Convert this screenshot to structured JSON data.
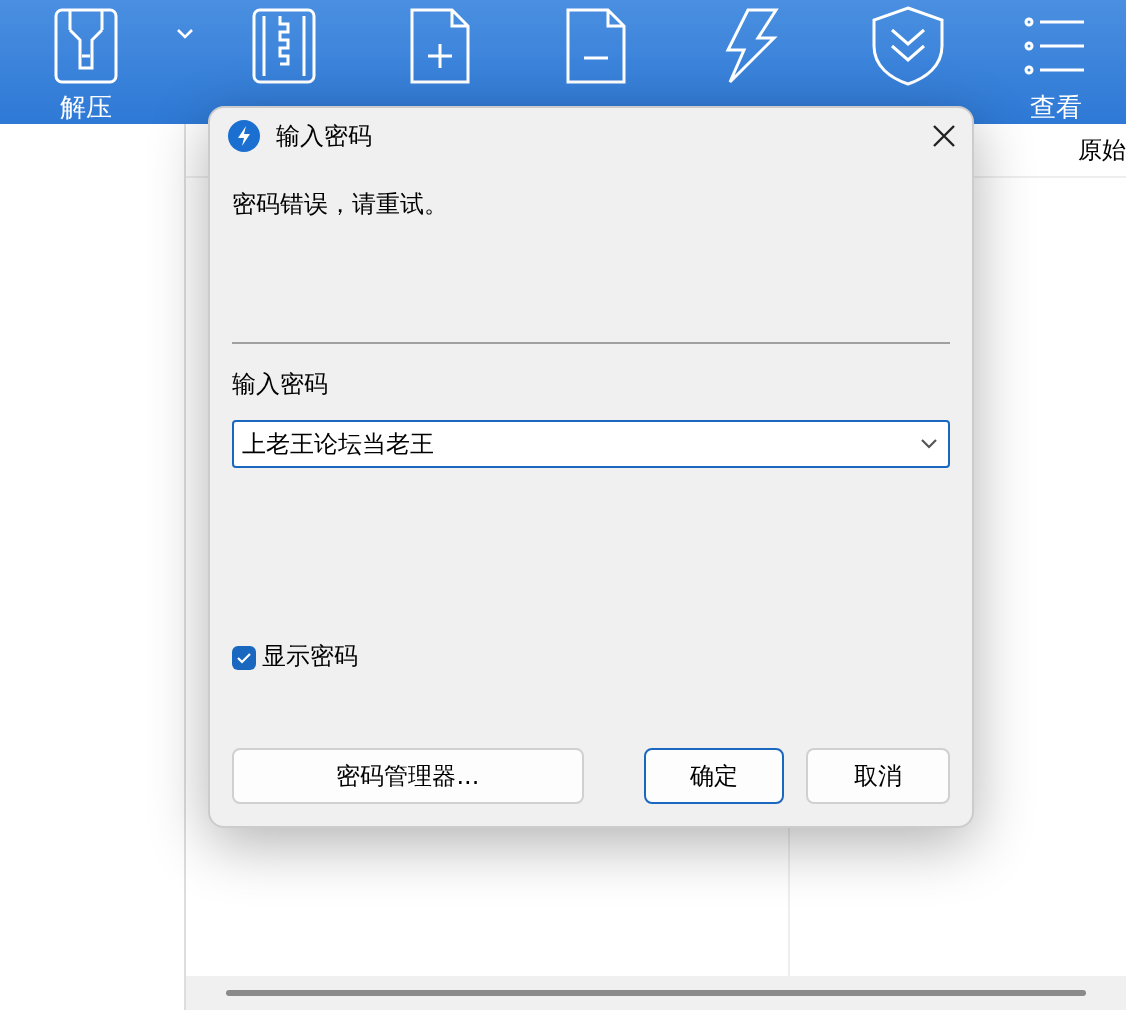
{
  "toolbar": {
    "items": [
      {
        "label": "解压",
        "kind": "extract",
        "dropdown": true
      },
      {
        "kind": "new",
        "dropdown": false
      },
      {
        "kind": "add",
        "dropdown": false
      },
      {
        "kind": "delete",
        "dropdown": false
      },
      {
        "kind": "test",
        "dropdown": false
      },
      {
        "kind": "scan",
        "dropdown": false
      },
      {
        "label": "查看",
        "kind": "view",
        "dropdown": false
      }
    ]
  },
  "file_list": {
    "columns": [
      "原始"
    ]
  },
  "dialog": {
    "title": "输入密码",
    "message": "密码错误，请重试。",
    "field_label": "输入密码",
    "password": {
      "value": "上老王论坛当老王"
    },
    "show_password": {
      "label": "显示密码",
      "checked": true
    },
    "buttons": [
      {
        "label": "密码管理器...",
        "kind": "manager",
        "default": false
      },
      {
        "label": "确定",
        "kind": "ok",
        "default": true
      },
      {
        "label": "取消",
        "kind": "cancel",
        "default": false
      }
    ]
  }
}
